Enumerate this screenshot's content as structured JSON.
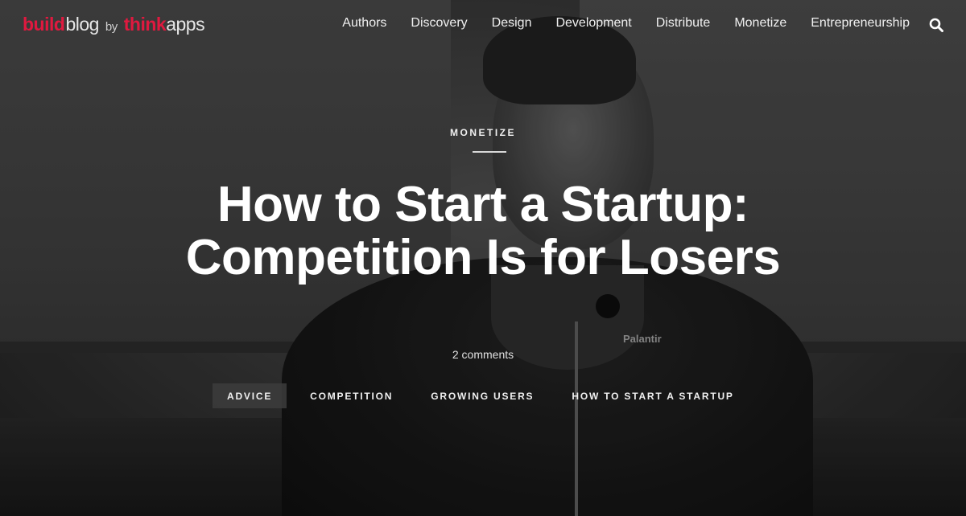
{
  "logo": {
    "part1": "build",
    "part2": "blog",
    "part3": "by",
    "part4": "think",
    "part5": "apps"
  },
  "nav": {
    "items": [
      "Authors",
      "Discovery",
      "Design",
      "Development",
      "Distribute",
      "Monetize",
      "Entrepreneurship"
    ],
    "search_icon": "search-icon"
  },
  "hero": {
    "category": "MONETIZE",
    "title_line1": "How to Start a Startup:",
    "title_line2": "Competition Is for Losers",
    "comments": "2 comments",
    "background_text": "Palantir",
    "tags": [
      "ADVICE",
      "COMPETITION",
      "GROWING USERS",
      "HOW TO START A STARTUP"
    ]
  },
  "colors": {
    "brand_red": "#e0193f",
    "text": "#ffffff"
  }
}
